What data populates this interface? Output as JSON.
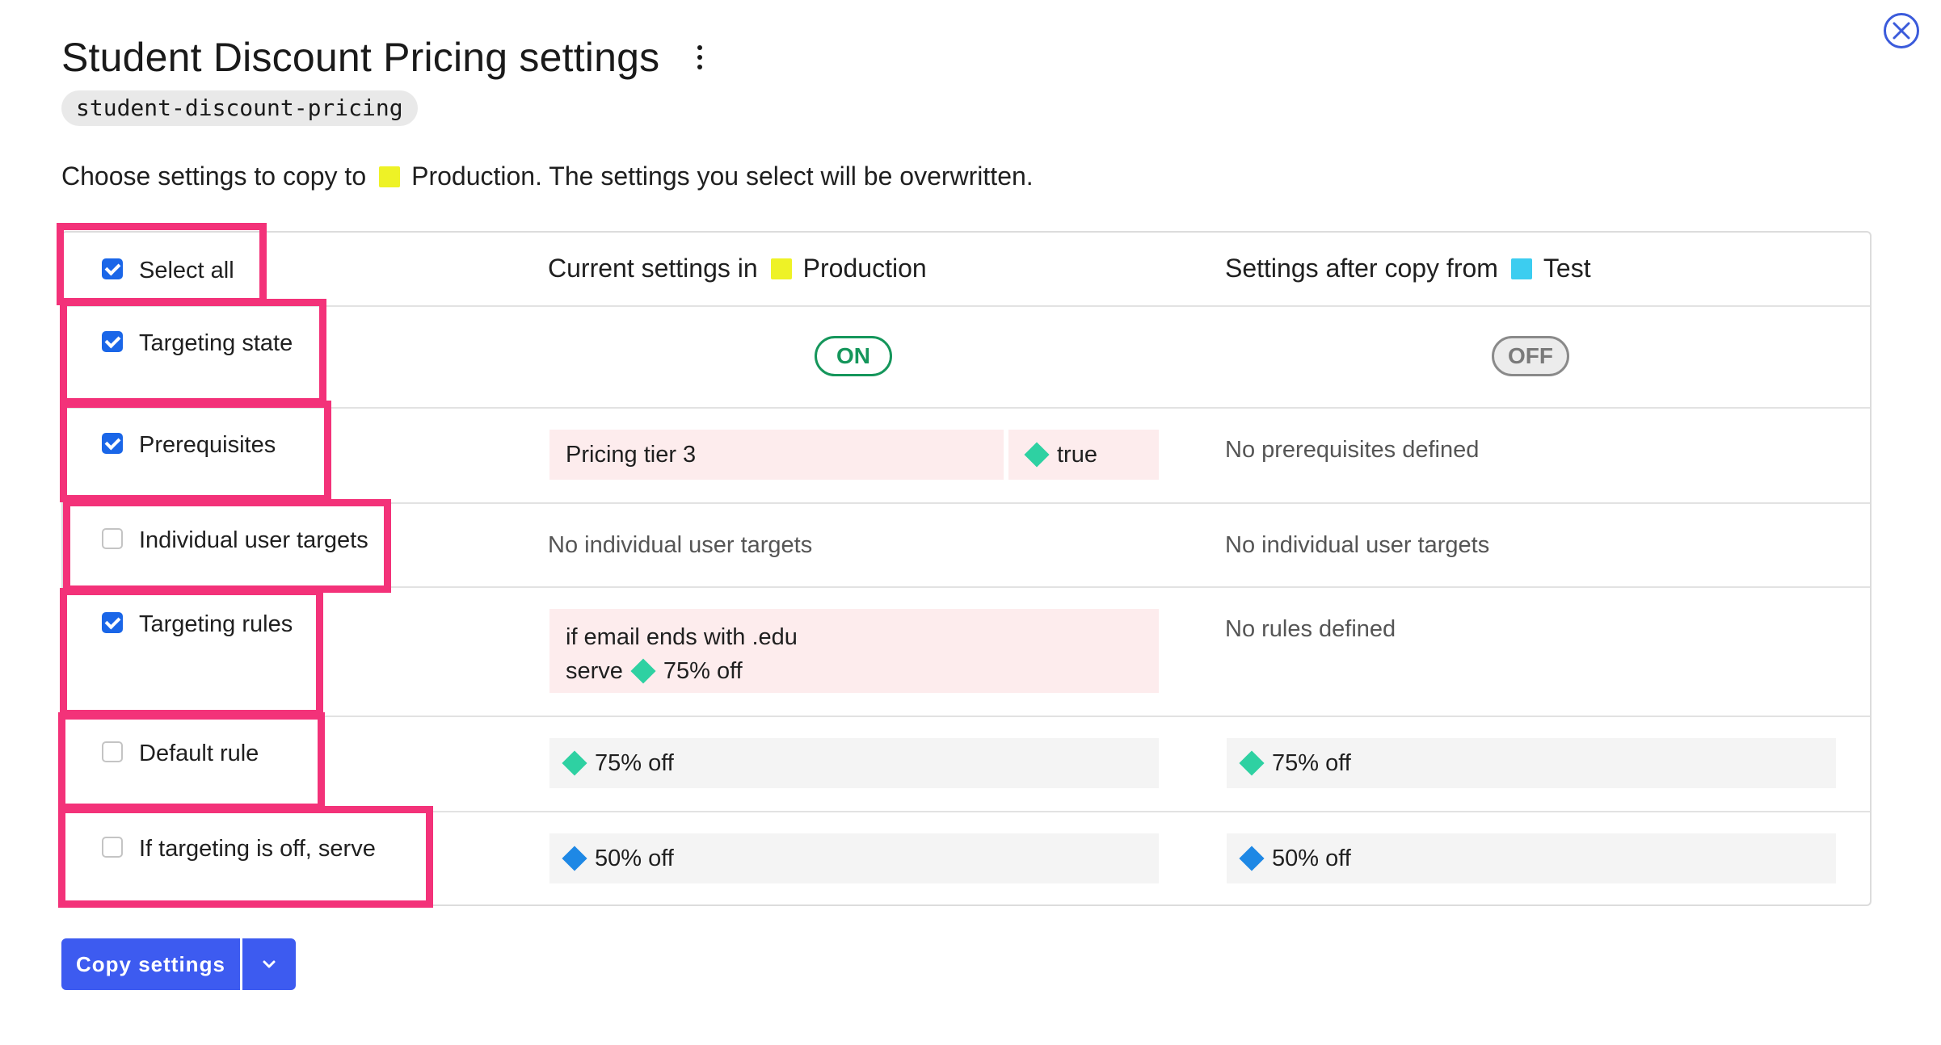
{
  "header": {
    "title": "Student Discount Pricing settings",
    "flag_key": "student-discount-pricing"
  },
  "intro": {
    "prefix": "Choose settings to copy to",
    "target_env": "Production",
    "suffix": ". The settings you select will be overwritten."
  },
  "environments": {
    "production_color": "#eef226",
    "test_color": "#3ccdf0"
  },
  "variation_colors": {
    "green": "#2ed1a2",
    "blue": "#1e88e5"
  },
  "table": {
    "select_all": {
      "label": "Select all",
      "checked": true
    },
    "current_header_prefix": "Current settings in",
    "current_header_env": "Production",
    "after_header_prefix": "Settings after copy from",
    "after_header_env": "Test",
    "rows": {
      "targeting_state": {
        "label": "Targeting state",
        "checked": true,
        "current": "ON",
        "after": "OFF"
      },
      "prerequisites": {
        "label": "Prerequisites",
        "checked": true,
        "current_flag": "Pricing tier 3",
        "current_value": "true",
        "after": "No prerequisites defined"
      },
      "individual_targets": {
        "label": "Individual user targets",
        "checked": false,
        "current": "No individual user targets",
        "after": "No individual user targets"
      },
      "targeting_rules": {
        "label": "Targeting rules",
        "checked": true,
        "current_line1": "if email ends with .edu",
        "current_serve": "serve",
        "current_variation": "75% off",
        "after": "No rules defined"
      },
      "default_rule": {
        "label": "Default rule",
        "checked": false,
        "current": "75% off",
        "after": "75% off"
      },
      "off_variation": {
        "label": "If targeting is off, serve",
        "checked": false,
        "current": "50% off",
        "after": "50% off"
      }
    }
  },
  "footer": {
    "copy_label": "Copy settings"
  }
}
